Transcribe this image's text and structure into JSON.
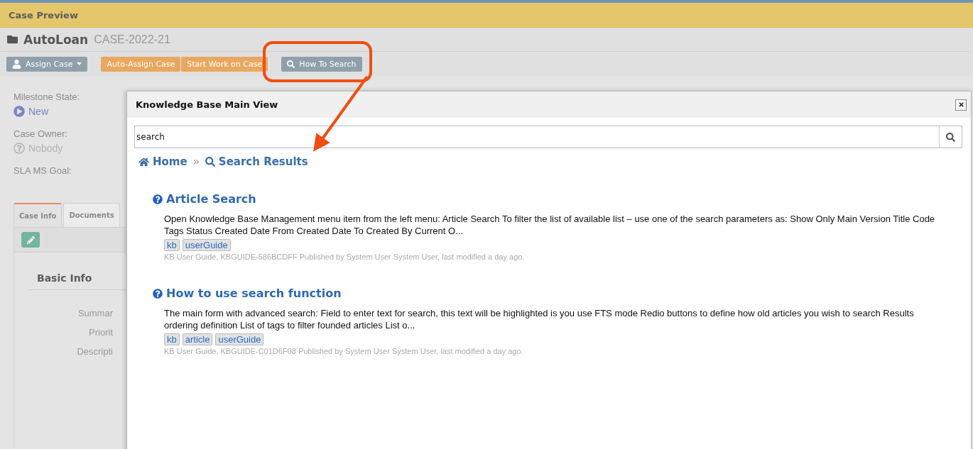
{
  "header": {
    "title": "Case Preview"
  },
  "case": {
    "name": "AutoLoan",
    "id": "CASE-2022-21"
  },
  "toolbar": [
    {
      "label": "Assign Case",
      "kind": "assign"
    },
    {
      "label": "Auto-Assign Case",
      "kind": "orange"
    },
    {
      "label": "Start Work on Case",
      "kind": "orange"
    },
    {
      "label": "How To Search",
      "kind": "search"
    }
  ],
  "sidebar": [
    {
      "label": "Milestone State:",
      "value": "New",
      "kind": "play"
    },
    {
      "label": "Case Owner:",
      "value": "Nobody",
      "kind": "unknown"
    },
    {
      "label": "SLA MS Goal:",
      "kind": "plain"
    }
  ],
  "tabs": [
    {
      "label": "Case Info",
      "selected": true
    },
    {
      "label": "Documents",
      "selected": false
    }
  ],
  "basic_info": {
    "title": "Basic Info",
    "fields": [
      "Summar",
      "Priorit",
      "Descripti"
    ]
  },
  "modal": {
    "title": "Knowledge Base Main View",
    "search": {
      "value": "search"
    },
    "separator": "»",
    "breadcrumb": [
      {
        "label": "Home",
        "kind": "home"
      },
      {
        "label": "Search Results",
        "kind": "search"
      }
    ],
    "results": [
      {
        "title": "Article Search",
        "snippet": "Open Knowledge Base Management menu item from the left menu: Article Search To filter the list of available list – use one of the search parameters as: Show Only Main Version Title Code Tags Status Created Date From Created Date To Created By Current O...",
        "tags": [
          "kb",
          "userGuide"
        ],
        "meta": "KB User Guide, KBGUIDE-586BCDFF Published by System User System User, last modified a day ago."
      },
      {
        "title": "How to use search function",
        "snippet": "The main form with advanced search: Field to enter text for search, this text will be highlighted is you use FTS mode Redio buttons to define how old articles you wish to search Results ordering definition List of tags to filter founded articles List o...",
        "tags": [
          "kb",
          "article",
          "userGuide"
        ],
        "meta": "KB User Guide, KBGUIDE-C01D6F08 Published by System User System User, last modified a day ago."
      }
    ]
  }
}
